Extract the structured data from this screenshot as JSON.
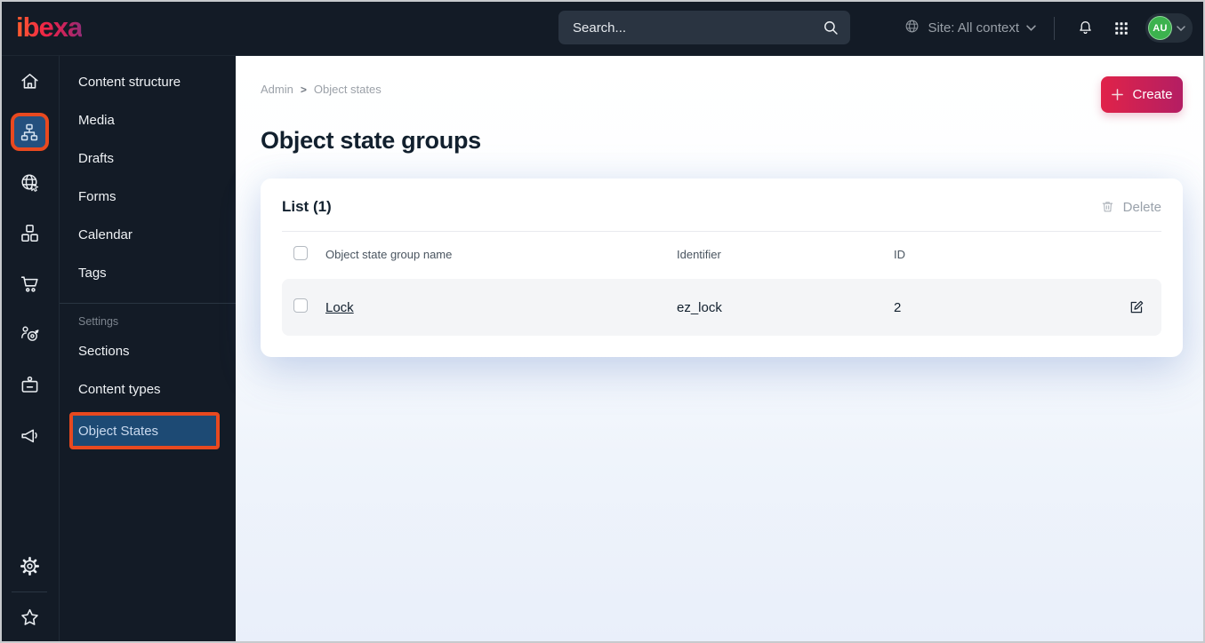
{
  "topbar": {
    "logo_text": "ibexa",
    "search": {
      "placeholder": "Search..."
    },
    "site_selector_label": "Site: All context",
    "avatar_initials": "AU"
  },
  "sidebar": {
    "icons": [
      "home-icon",
      "content-structure-icon",
      "site-globe-icon",
      "product-boxes-icon",
      "cart-icon",
      "personalization-target-icon",
      "customer-badge-icon",
      "megaphone-icon",
      "gear-icon",
      "star-icon"
    ],
    "active_icon": "content-structure-icon"
  },
  "menu": {
    "items": [
      "Content structure",
      "Media",
      "Drafts",
      "Forms",
      "Calendar",
      "Tags"
    ],
    "section_label": "Settings",
    "section_items": [
      "Sections",
      "Content types",
      "Object States"
    ],
    "active_item": "Object States"
  },
  "main": {
    "breadcrumb": {
      "root": "Admin",
      "current": "Object states"
    },
    "title": "Object state groups",
    "create_button": "Create",
    "list": {
      "header": "List (1)",
      "delete_button": "Delete",
      "columns": {
        "name": "Object state group name",
        "identifier": "Identifier",
        "id": "ID"
      },
      "rows": [
        {
          "name": "Lock",
          "identifier": "ez_lock",
          "id": "2"
        }
      ]
    }
  },
  "colors": {
    "topbar_bg": "#131b26",
    "accent_gradient_start": "#e02349",
    "accent_gradient_end": "#b41e63",
    "annotation_orange": "#e8491f",
    "selected_blue": "#1d4a74",
    "avatar_green": "#3cb24e"
  }
}
